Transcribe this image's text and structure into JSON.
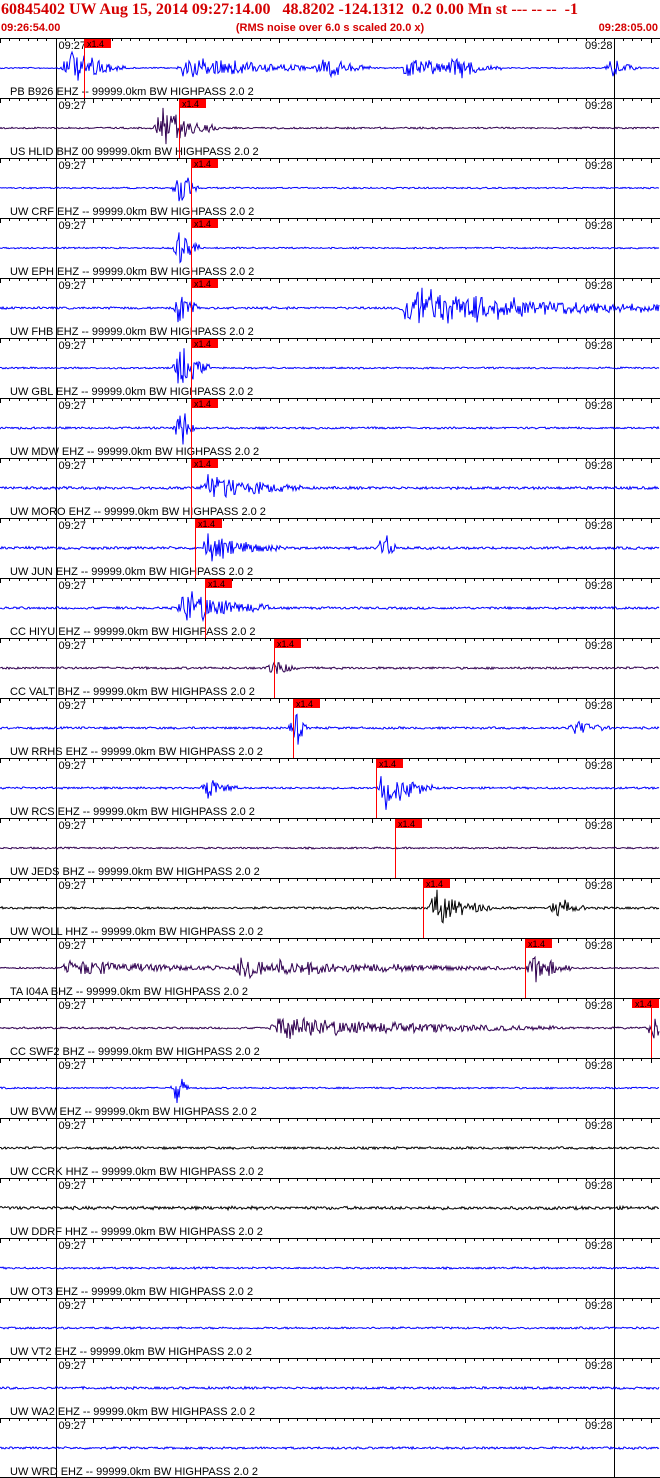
{
  "header": {
    "title": "60845402 UW Aug 15, 2014 09:27:14.00   48.8202 -124.1312  0.2 0.00 Mn st --- -- --  -1",
    "start_time": "09:26:54.00",
    "note": "(RMS noise over 6.0 s scaled 20.0 x)",
    "end_time": "09:28:05.00"
  },
  "chart_data": {
    "type": "line",
    "title": "60845402 UW Aug 15, 2014 09:27:14.00   48.8202 -124.1312  0.2 0.00 Mn st --- -- --  -1",
    "x_start": "09:26:54.00",
    "x_end": "09:28:05.00",
    "x_range_seconds": [
      0,
      71
    ],
    "tick_labels": [
      "09:27",
      "09:28"
    ],
    "tick_seconds": [
      6,
      66
    ],
    "pick_label": "x1.4",
    "colors": {
      "header": "#d40000",
      "pick": "#ff0000",
      "grid": "#000000"
    },
    "traces": [
      {
        "label": "PB B926 EHZ -- 99999.0km BW  HIGHPASS  2.0  2",
        "color": "#0000ff",
        "pick_s": 9.0,
        "noise": 0.8,
        "events": [
          [
            7.5,
            0.9,
            6
          ],
          [
            20.0,
            0.45,
            20
          ],
          [
            35.0,
            0.5,
            4
          ],
          [
            44.0,
            0.5,
            8
          ],
          [
            49.0,
            0.4,
            5
          ],
          [
            66.0,
            0.4,
            3
          ]
        ]
      },
      {
        "label": "US HLID BHZ 00 99999.0km BW  HIGHPASS  2.0  2",
        "color": "#300050",
        "pick_s": 19.3,
        "noise": 1.0,
        "events": [
          [
            17.5,
            0.9,
            6
          ]
        ]
      },
      {
        "label": "UW CRF EHZ -- 99999.0km BW  HIGHPASS  2.0  2",
        "color": "#0000ff",
        "pick_s": 20.5,
        "noise": 0.9,
        "events": [
          [
            19.5,
            1.0,
            2
          ]
        ]
      },
      {
        "label": "UW EPH EHZ -- 99999.0km BW  HIGHPASS  2.0  2",
        "color": "#0000ff",
        "pick_s": 20.5,
        "noise": 0.9,
        "events": [
          [
            19.5,
            0.9,
            2
          ]
        ]
      },
      {
        "label": "UW FHB EHZ -- 99999.0km BW  HIGHPASS  2.0  2",
        "color": "#0000ff",
        "pick_s": 20.5,
        "noise": 1.3,
        "events": [
          [
            19.5,
            1.0,
            2
          ],
          [
            44.0,
            0.85,
            30
          ]
        ]
      },
      {
        "label": "UW GBL EHZ -- 99999.0km BW  HIGHPASS  2.0  2",
        "color": "#0000ff",
        "pick_s": 20.5,
        "noise": 1.0,
        "events": [
          [
            19.5,
            1.0,
            3
          ]
        ]
      },
      {
        "label": "UW MDW EHZ -- 99999.0km BW  HIGHPASS  2.0  2",
        "color": "#0000ff",
        "pick_s": 20.5,
        "noise": 1.2,
        "events": [
          [
            19.5,
            0.8,
            2
          ]
        ]
      },
      {
        "label": "UW MORO EHZ -- 99999.0km BW  HIGHPASS  2.0  2",
        "color": "#0000ff",
        "pick_s": 20.5,
        "noise": 1.6,
        "events": [
          [
            22.5,
            0.6,
            10
          ]
        ]
      },
      {
        "label": "UW JUN EHZ -- 99999.0km BW  HIGHPASS  2.0  2",
        "color": "#0000ff",
        "pick_s": 21.0,
        "noise": 1.6,
        "events": [
          [
            22.5,
            0.55,
            8
          ],
          [
            41.5,
            0.8,
            1
          ]
        ]
      },
      {
        "label": "CC HIYU EHZ -- 99999.0km BW  HIGHPASS  2.0  2",
        "color": "#0000ff",
        "pick_s": 22.0,
        "noise": 1.4,
        "events": [
          [
            20.0,
            0.8,
            9
          ]
        ]
      },
      {
        "label": "CC VALT BHZ -- 99999.0km BW  HIGHPASS  2.0  2",
        "color": "#300050",
        "pick_s": 29.5,
        "noise": 1.3,
        "events": [
          [
            29.5,
            0.35,
            3
          ]
        ]
      },
      {
        "label": "UW RRHS EHZ -- 99999.0km BW  HIGHPASS  2.0  2",
        "color": "#0000ff",
        "pick_s": 31.5,
        "noise": 1.3,
        "events": [
          [
            32.0,
            0.9,
            1
          ],
          [
            62.0,
            0.35,
            4
          ]
        ]
      },
      {
        "label": "UW RCS EHZ -- 99999.0km BW  HIGHPASS  2.0  2",
        "color": "#0000ff",
        "pick_s": 40.5,
        "noise": 1.2,
        "events": [
          [
            41.5,
            1.0,
            5
          ],
          [
            22.5,
            0.5,
            3
          ]
        ]
      },
      {
        "label": "UW JEDS BHZ -- 99999.0km BW  HIGHPASS  2.0  2",
        "color": "#300050",
        "pick_s": 42.5,
        "noise": 1.0,
        "events": []
      },
      {
        "label": "UW WOLL HHZ -- 99999.0km BW  HIGHPASS  2.0  2",
        "color": "#000000",
        "pick_s": 45.5,
        "noise": 1.3,
        "events": [
          [
            47.0,
            0.75,
            6
          ],
          [
            60.0,
            0.45,
            3
          ]
        ]
      },
      {
        "label": "TA I04A BHZ -- 99999.0km BW  HIGHPASS  2.0  2",
        "color": "#300050",
        "pick_s": 56.5,
        "noise": 0.9,
        "events": [
          [
            57.5,
            0.8,
            4
          ],
          [
            7.5,
            0.35,
            20
          ],
          [
            26.0,
            0.4,
            30
          ]
        ]
      },
      {
        "label": "CC SWF2 BHZ -- 99999.0km BW  HIGHPASS  2.0  2",
        "color": "#300050",
        "pick_s": 70.0,
        "noise": 1.2,
        "events": [
          [
            30.0,
            0.45,
            30
          ],
          [
            70.5,
            0.65,
            2
          ]
        ]
      },
      {
        "label": "UW BVW EHZ -- 99999.0km BW  HIGHPASS  2.0  2",
        "color": "#0000ff",
        "pick_s": null,
        "noise": 1.0,
        "events": [
          [
            19.3,
            0.8,
            1
          ]
        ]
      },
      {
        "label": "UW CCRK HHZ -- 99999.0km BW  HIGHPASS  2.0  2",
        "color": "#000000",
        "pick_s": null,
        "noise": 1.4,
        "events": []
      },
      {
        "label": "UW DDRF HHZ -- 99999.0km BW  HIGHPASS  2.0  2",
        "color": "#000000",
        "pick_s": null,
        "noise": 1.9,
        "events": []
      },
      {
        "label": "UW OT3 EHZ -- 99999.0km BW  HIGHPASS  2.0  2",
        "color": "#0000ff",
        "pick_s": null,
        "noise": 1.1,
        "events": []
      },
      {
        "label": "UW VT2 EHZ -- 99999.0km BW  HIGHPASS  2.0  2",
        "color": "#0000ff",
        "pick_s": null,
        "noise": 1.2,
        "events": []
      },
      {
        "label": "UW WA2 EHZ -- 99999.0km BW  HIGHPASS  2.0  2",
        "color": "#0000ff",
        "pick_s": null,
        "noise": 1.4,
        "events": []
      },
      {
        "label": "UW WRD EHZ -- 99999.0km BW  HIGHPASS  2.0  2",
        "color": "#0000ff",
        "pick_s": null,
        "noise": 1.3,
        "events": []
      }
    ]
  }
}
